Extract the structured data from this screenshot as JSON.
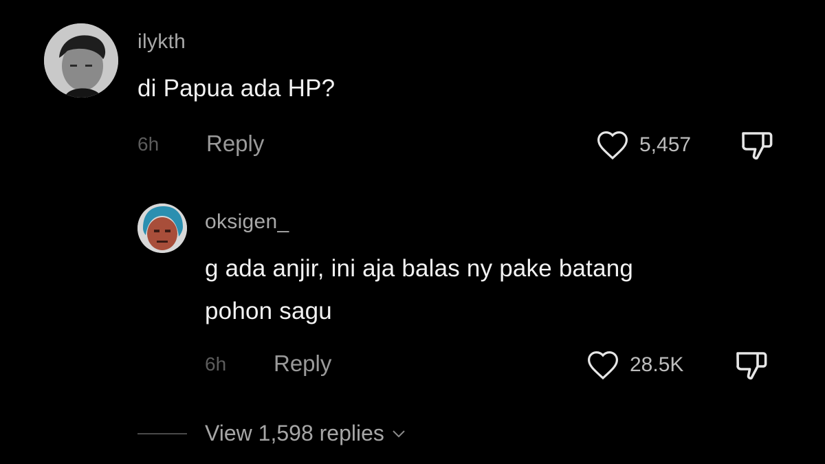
{
  "comments": [
    {
      "username": "ilykth",
      "text": "di Papua ada HP?",
      "time": "6h",
      "reply_label": "Reply",
      "likes": "5,457"
    },
    {
      "username": "oksigen_",
      "text_line1": "g ada anjir, ini aja balas ny pake batang",
      "text_line2": "pohon sagu",
      "time": "6h",
      "reply_label": "Reply",
      "likes": "28.5K"
    }
  ],
  "view_replies_label": "View 1,598 replies",
  "icons": {
    "like": "heart-outline-icon",
    "dislike": "thumbs-down-icon",
    "expand": "chevron-down-icon"
  },
  "colors": {
    "background": "#000000",
    "username": "#a9a9a9",
    "text": "#f2f2f2",
    "muted": "#5c5c5c",
    "reply": "#9a9a9a"
  }
}
